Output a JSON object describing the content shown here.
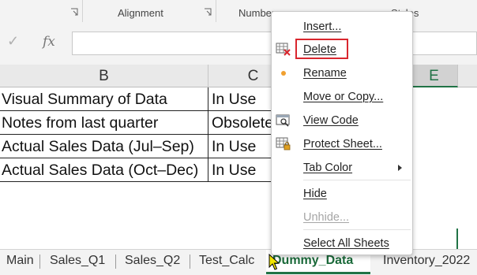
{
  "ribbon": {
    "groups": [
      "Alignment",
      "Number",
      "Styles"
    ]
  },
  "formula_bar": {
    "fx_label": "fx",
    "value": ""
  },
  "sheet": {
    "column_headers": [
      "B",
      "C",
      "E"
    ],
    "rows": [
      {
        "b": "Visual Summary of Data",
        "c": "In Use"
      },
      {
        "b": "Notes from last quarter",
        "c": "Obsolete"
      },
      {
        "b": "Actual Sales Data (Jul–Sep)",
        "c": "In Use"
      },
      {
        "b": "Actual Sales Data (Oct–Dec)",
        "c": "In Use"
      }
    ]
  },
  "tabs": {
    "items": [
      "Main",
      "Sales_Q1",
      "Sales_Q2",
      "Test_Calc",
      "Dummy_Data",
      "Inventory_2022"
    ],
    "active": "Dummy_Data"
  },
  "context_menu": {
    "items": [
      {
        "label": "Insert...",
        "icon": "none",
        "enabled": true
      },
      {
        "label": "Delete",
        "icon": "delete-sheet-icon",
        "enabled": true,
        "highlighted": true
      },
      {
        "label": "Rename",
        "icon": "dot-icon",
        "enabled": true
      },
      {
        "label": "Move or Copy...",
        "icon": "none",
        "enabled": true
      },
      {
        "label": "View Code",
        "icon": "view-code-icon",
        "enabled": true
      },
      {
        "label": "Protect Sheet...",
        "icon": "protect-sheet-icon",
        "enabled": true
      },
      {
        "label": "Tab Color",
        "icon": "none",
        "enabled": true,
        "submenu": true
      },
      {
        "label": "Hide",
        "icon": "none",
        "enabled": true
      },
      {
        "label": "Unhide...",
        "icon": "none",
        "enabled": false
      },
      {
        "label": "Select All Sheets",
        "icon": "none",
        "enabled": true
      }
    ]
  },
  "colors": {
    "excel_green": "#217346",
    "highlight_red": "#d9262e"
  }
}
